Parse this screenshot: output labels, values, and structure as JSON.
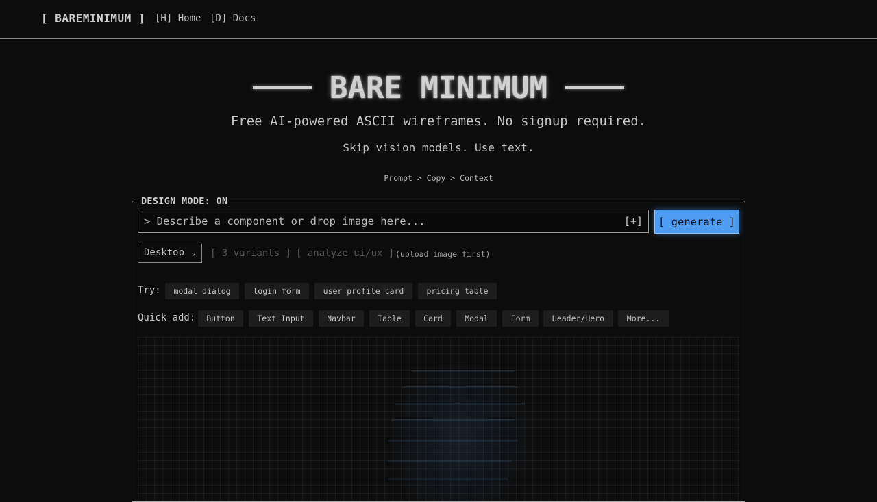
{
  "nav": {
    "brand": "[ BAREMINIMUM ]",
    "home": "[H] Home",
    "docs": "[D] Docs"
  },
  "hero": {
    "title": "BARE MINIMUM",
    "subtitle": "Free AI-powered ASCII wireframes. No signup required.",
    "tagline": "Skip vision models. Use text.",
    "flow": "Prompt > Copy > Context"
  },
  "panel": {
    "legend": "DESIGN MODE: ON",
    "prompt_placeholder": "> Describe a component or drop image here...",
    "attach_label": "[+]",
    "generate_label": "[ generate ]",
    "device_selected": "Desktop",
    "variants_label": "[ 3 variants ]",
    "analyze_label": "[ analyze ui/ux ]",
    "analyze_hint": "(upload image first)",
    "try_label": "Try:",
    "try_items": [
      "modal dialog",
      "login form",
      "user profile card",
      "pricing table"
    ],
    "quick_add_label": "Quick add:",
    "quick_add_items": [
      "Button",
      "Text Input",
      "Navbar",
      "Table",
      "Card",
      "Modal",
      "Form",
      "Header/Hero",
      "More..."
    ]
  },
  "colors": {
    "background": "#0c0c0c",
    "accent": "#4f9cf3",
    "chip": "#1d1d1d",
    "text": "#c8c8c8"
  }
}
